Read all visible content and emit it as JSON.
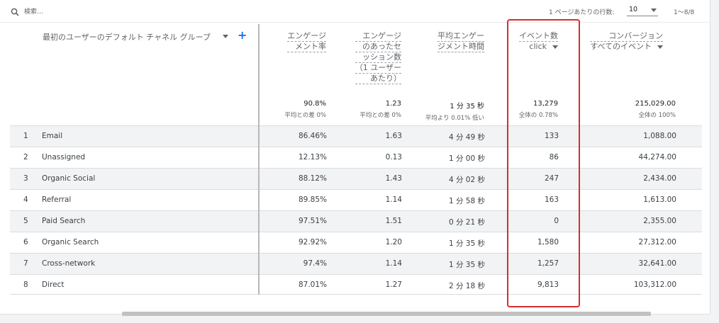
{
  "toolbar": {
    "search_placeholder": "検索…",
    "rows_per_page_label": "1 ページあたりの行数:",
    "rows_per_page_value": "10",
    "pagination": "1〜8/8"
  },
  "header": {
    "dimension": "最初のユーザーのデフォルト チャネル グループ",
    "add_dimension": "+",
    "engagement_rate": [
      "エンゲージ",
      "メント率"
    ],
    "engaged_sessions": [
      "エンゲージ",
      "のあったセ",
      "ッション数",
      "（1 ユーザー",
      "あたり）"
    ],
    "avg_engagement_time": [
      "平均エンゲー",
      "ジメント時間"
    ],
    "event_count": {
      "title": "イベント数",
      "filter": "click"
    },
    "conversions": {
      "title": "コンバージョン",
      "filter": "すべてのイベント"
    }
  },
  "totals": {
    "engagement_rate": {
      "value": "90.8%",
      "sub": "平均との差 0%"
    },
    "engaged_sessions": {
      "value": "1.23",
      "sub": "平均との差 0%"
    },
    "avg_engagement_time": {
      "value": "1 分 35 秒",
      "sub": "平均より 0.01% 低い"
    },
    "event_count": {
      "value": "13,279",
      "sub": "全体の 0.78%"
    },
    "conversions": {
      "value": "215,029.00",
      "sub": "全体の 100%"
    }
  },
  "rows": [
    {
      "rank": "1",
      "channel": "Email",
      "engagement_rate": "86.46%",
      "engaged_sessions": "1.63",
      "avg_time": "4 分 49 秒",
      "events": "133",
      "conversions": "1,088.00"
    },
    {
      "rank": "2",
      "channel": "Unassigned",
      "engagement_rate": "12.13%",
      "engaged_sessions": "0.13",
      "avg_time": "1 分 00 秒",
      "events": "86",
      "conversions": "44,274.00"
    },
    {
      "rank": "3",
      "channel": "Organic Social",
      "engagement_rate": "88.12%",
      "engaged_sessions": "1.43",
      "avg_time": "4 分 02 秒",
      "events": "247",
      "conversions": "2,434.00"
    },
    {
      "rank": "4",
      "channel": "Referral",
      "engagement_rate": "89.85%",
      "engaged_sessions": "1.14",
      "avg_time": "1 分 58 秒",
      "events": "163",
      "conversions": "1,613.00"
    },
    {
      "rank": "5",
      "channel": "Paid Search",
      "engagement_rate": "97.51%",
      "engaged_sessions": "1.51",
      "avg_time": "0 分 21 秒",
      "events": "0",
      "conversions": "2,355.00"
    },
    {
      "rank": "6",
      "channel": "Organic Search",
      "engagement_rate": "92.92%",
      "engaged_sessions": "1.20",
      "avg_time": "1 分 35 秒",
      "events": "1,580",
      "conversions": "27,312.00"
    },
    {
      "rank": "7",
      "channel": "Cross-network",
      "engagement_rate": "97.4%",
      "engaged_sessions": "1.14",
      "avg_time": "1 分 35 秒",
      "events": "1,257",
      "conversions": "32,641.00"
    },
    {
      "rank": "8",
      "channel": "Direct",
      "engagement_rate": "87.01%",
      "engaged_sessions": "1.27",
      "avg_time": "2 分 18 秒",
      "events": "9,813",
      "conversions": "103,312.00"
    }
  ],
  "colors": {
    "highlight": "#d32f2f",
    "accent": "#1a73e8",
    "row_alt": "#f1f3f4"
  }
}
